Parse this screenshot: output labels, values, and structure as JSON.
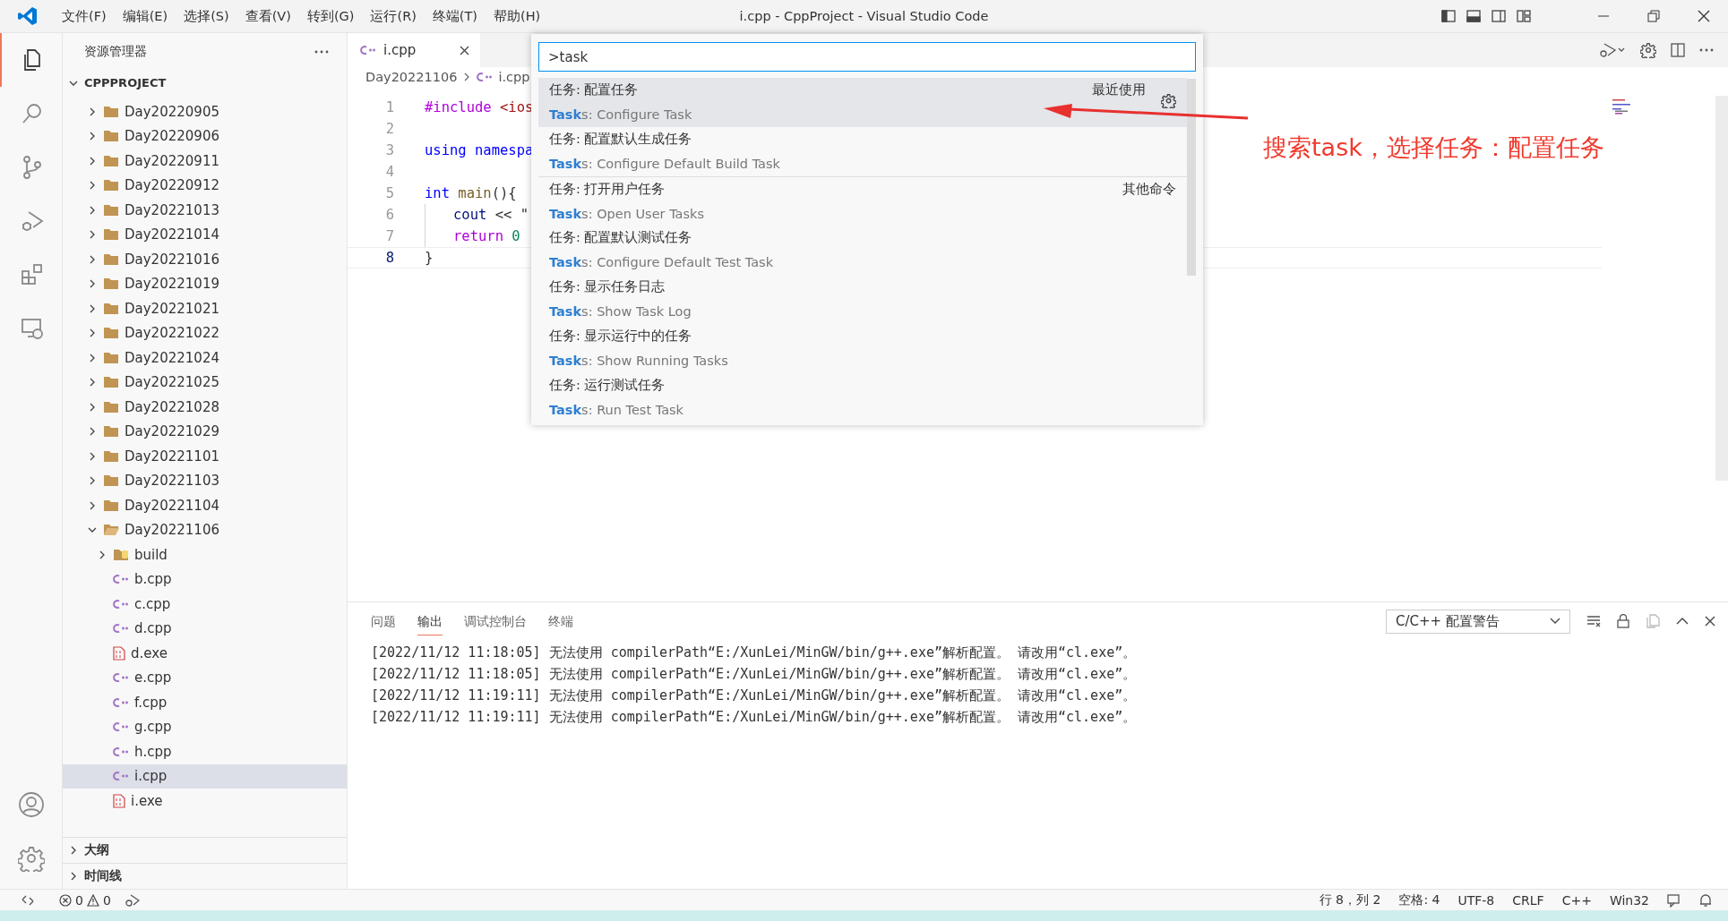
{
  "window": {
    "title": "i.cpp - CppProject - Visual Studio Code"
  },
  "menu": [
    "文件(F)",
    "编辑(E)",
    "选择(S)",
    "查看(V)",
    "转到(G)",
    "运行(R)",
    "终端(T)",
    "帮助(H)"
  ],
  "activity_bar": [
    {
      "kind": "explorer",
      "selected": true
    },
    {
      "kind": "search",
      "selected": false
    },
    {
      "kind": "source-control",
      "selected": false
    },
    {
      "kind": "run-debug",
      "selected": false
    },
    {
      "kind": "extensions",
      "selected": false
    },
    {
      "kind": "remote",
      "selected": false
    }
  ],
  "activity_bottom": [
    {
      "kind": "account"
    },
    {
      "kind": "settings"
    }
  ],
  "sidebar": {
    "title": "资源管理器",
    "tree": {
      "label": "CPPPROJECT",
      "expanded": true,
      "children": [
        {
          "label": "Day20220905",
          "kind": "folder",
          "expanded": false,
          "selected": false
        },
        {
          "label": "Day20220906",
          "kind": "folder",
          "expanded": false,
          "selected": false
        },
        {
          "label": "Day20220911",
          "kind": "folder",
          "expanded": false,
          "selected": false
        },
        {
          "label": "Day20220912",
          "kind": "folder",
          "expanded": false,
          "selected": false
        },
        {
          "label": "Day20221013",
          "kind": "folder",
          "expanded": false,
          "selected": false
        },
        {
          "label": "Day20221014",
          "kind": "folder",
          "expanded": false,
          "selected": false
        },
        {
          "label": "Day20221016",
          "kind": "folder",
          "expanded": false,
          "selected": false
        },
        {
          "label": "Day20221019",
          "kind": "folder",
          "expanded": false,
          "selected": false
        },
        {
          "label": "Day20221021",
          "kind": "folder",
          "expanded": false,
          "selected": false
        },
        {
          "label": "Day20221022",
          "kind": "folder",
          "expanded": false,
          "selected": false
        },
        {
          "label": "Day20221024",
          "kind": "folder",
          "expanded": false,
          "selected": false
        },
        {
          "label": "Day20221025",
          "kind": "folder",
          "expanded": false,
          "selected": false
        },
        {
          "label": "Day20221028",
          "kind": "folder",
          "expanded": false,
          "selected": false
        },
        {
          "label": "Day20221029",
          "kind": "folder",
          "expanded": false,
          "selected": false
        },
        {
          "label": "Day20221101",
          "kind": "folder",
          "expanded": false,
          "selected": false
        },
        {
          "label": "Day20221103",
          "kind": "folder",
          "expanded": false,
          "selected": false
        },
        {
          "label": "Day20221104",
          "kind": "folder",
          "expanded": false,
          "selected": false
        },
        {
          "label": "Day20221106",
          "kind": "folder",
          "expanded": true,
          "selected": false,
          "children": [
            {
              "label": "build",
              "kind": "build-folder",
              "expanded": false,
              "selected": false
            },
            {
              "label": "b.cpp",
              "kind": "cpp",
              "selected": false
            },
            {
              "label": "c.cpp",
              "kind": "cpp",
              "selected": false
            },
            {
              "label": "d.cpp",
              "kind": "cpp",
              "selected": false
            },
            {
              "label": "d.exe",
              "kind": "exe",
              "selected": false
            },
            {
              "label": "e.cpp",
              "kind": "cpp",
              "selected": false
            },
            {
              "label": "f.cpp",
              "kind": "cpp",
              "selected": false
            },
            {
              "label": "g.cpp",
              "kind": "cpp",
              "selected": false
            },
            {
              "label": "h.cpp",
              "kind": "cpp",
              "selected": false
            },
            {
              "label": "i.cpp",
              "kind": "cpp",
              "selected": true
            },
            {
              "label": "i.exe",
              "kind": "exe",
              "selected": false
            }
          ]
        }
      ]
    },
    "sections": [
      {
        "label": "大纲",
        "expanded": false
      },
      {
        "label": "时间线",
        "expanded": false
      }
    ]
  },
  "editor": {
    "tabs": [
      {
        "label": "i.cpp",
        "selected": true
      }
    ],
    "breadcrumb": [
      "Day20221106",
      "i.cpp"
    ],
    "lines": [
      {
        "number": "1",
        "current": false,
        "in_block": false,
        "tokens": [
          {
            "text": "#include",
            "kind": "directive"
          },
          {
            "text": " <ios",
            "kind": "string"
          }
        ]
      },
      {
        "number": "2",
        "current": false,
        "in_block": false
      },
      {
        "number": "3",
        "current": false,
        "in_block": false,
        "tokens": [
          {
            "text": "using namespa",
            "kind": "keyword"
          }
        ]
      },
      {
        "number": "4",
        "current": false,
        "in_block": false
      },
      {
        "number": "5",
        "current": false,
        "in_block": false,
        "tokens": [
          {
            "text": "int",
            "kind": "keyword"
          },
          {
            "text": " main",
            "kind": "function"
          },
          {
            "text": "(){",
            "kind": "plain"
          }
        ]
      },
      {
        "number": "6",
        "current": false,
        "in_block": true,
        "tokens": [
          {
            "text": "cout",
            "kind": "variable"
          },
          {
            "text": " << \"",
            "kind": "plain"
          }
        ]
      },
      {
        "number": "7",
        "current": false,
        "in_block": true,
        "tokens": [
          {
            "text": "return",
            "kind": "control"
          },
          {
            "text": " 0",
            "kind": "number"
          }
        ]
      },
      {
        "number": "8",
        "current": true,
        "in_block": false,
        "tokens": [
          {
            "text": "}",
            "kind": "plain"
          }
        ]
      }
    ]
  },
  "command_palette": {
    "query": ">task",
    "items": [
      {
        "title": "任务: 配置任务",
        "detail": "**Task**s: Configure Task",
        "badge": "最近使用",
        "selected": true
      },
      {
        "title": "任务: 配置默认生成任务",
        "detail": "**Task**s: Configure Default Build Task",
        "selected": false
      },
      {
        "title": "任务: 打开用户任务",
        "detail": "**Task**s: Open User Tasks",
        "badge": "其他命令",
        "selected": false
      },
      {
        "title": "任务: 配置默认测试任务",
        "detail": "**Task**s: Configure Default Test Task",
        "selected": false
      },
      {
        "title": "任务: 显示任务日志",
        "detail": "**Task**s: Show Task Log",
        "selected": false
      },
      {
        "title": "任务: 显示运行中的任务",
        "detail": "**Task**s: Show Running Tasks",
        "selected": false
      },
      {
        "title": "任务: 运行测试任务",
        "detail": "**Task**s: Run Test Task",
        "selected": false
      }
    ]
  },
  "annotation": {
    "text": "搜索task，选择任务：配置任务"
  },
  "panel": {
    "tabs": [
      {
        "label": "问题",
        "selected": false
      },
      {
        "label": "输出",
        "selected": true
      },
      {
        "label": "调试控制台",
        "selected": false
      },
      {
        "label": "终端",
        "selected": false
      }
    ],
    "channel": "C/C++ 配置警告",
    "lines": [
      "[2022/11/12 11:18:05] 无法使用 compilerPath“E:/XunLei/MinGW/bin/g++.exe”解析配置。 请改用“cl.exe”。",
      "[2022/11/12 11:18:05] 无法使用 compilerPath“E:/XunLei/MinGW/bin/g++.exe”解析配置。 请改用“cl.exe”。",
      "[2022/11/12 11:19:11] 无法使用 compilerPath“E:/XunLei/MinGW/bin/g++.exe”解析配置。 请改用“cl.exe”。",
      "[2022/11/12 11:19:11] 无法使用 compilerPath“E:/XunLei/MinGW/bin/g++.exe”解析配置。 请改用“cl.exe”。"
    ]
  },
  "status_bar": {
    "errors": "0",
    "warnings": "0",
    "items": [
      "行 8，列 2",
      "空格: 4",
      "UTF-8",
      "CRLF",
      "C++",
      "Win32"
    ]
  }
}
